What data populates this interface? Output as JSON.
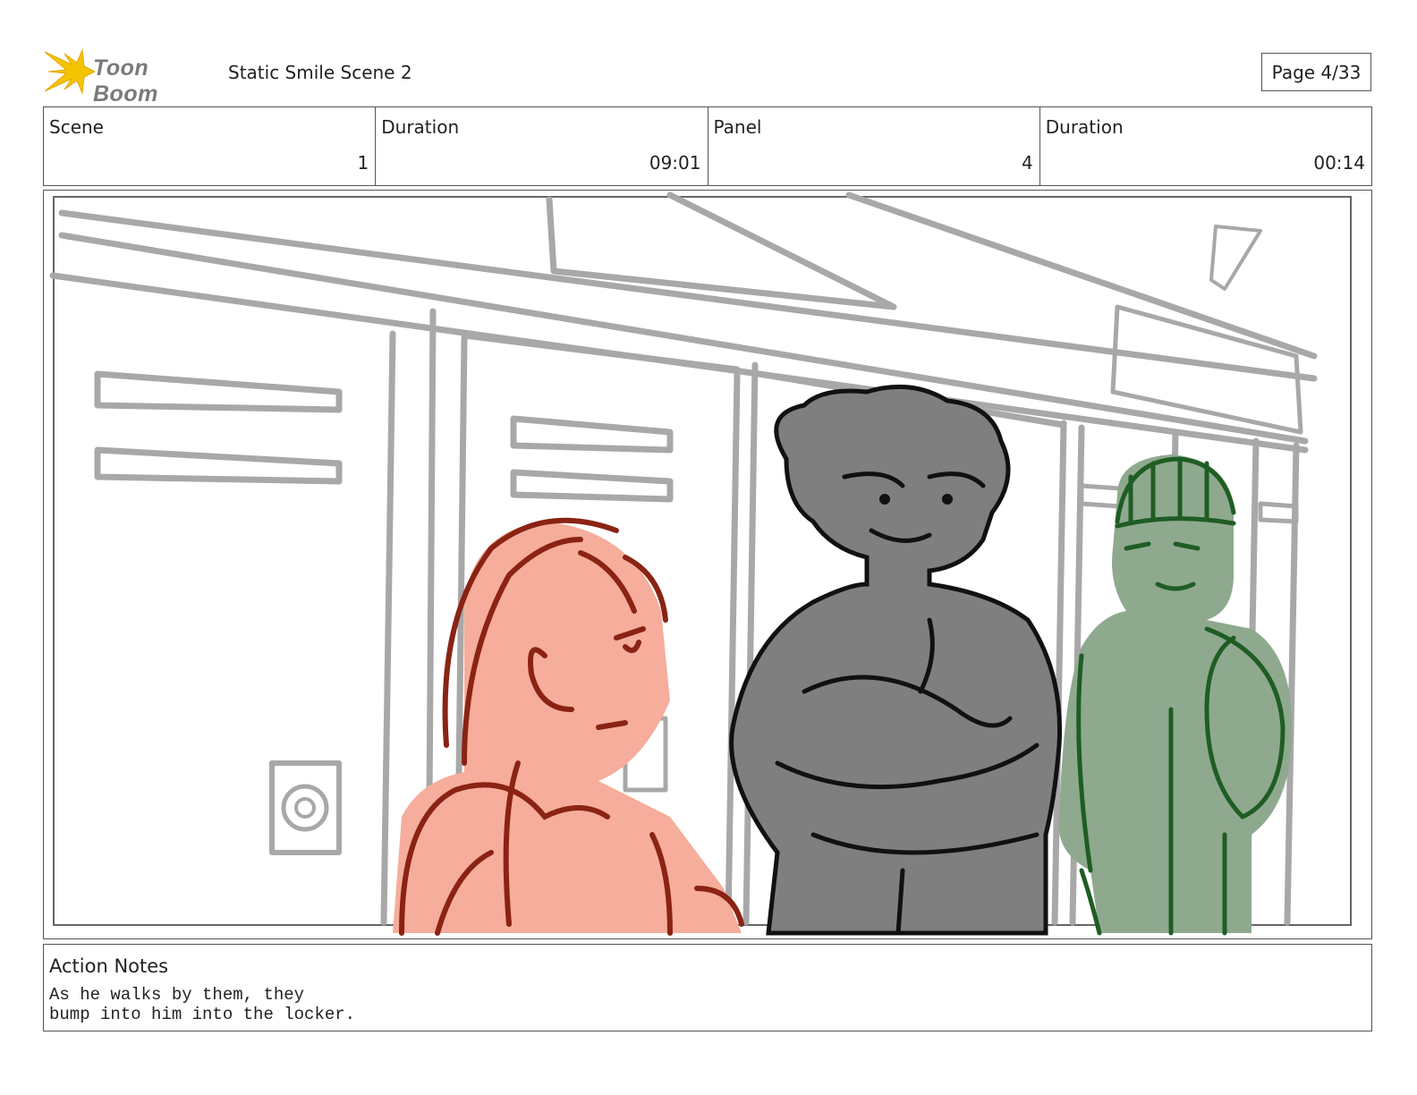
{
  "header": {
    "logo_text": "Toon Boom",
    "doc_title": "Static Smile Scene 2",
    "page": "Page  4/33"
  },
  "info": {
    "scene_label": "Scene",
    "scene_value": "1",
    "scene_duration_label": "Duration",
    "scene_duration_value": "09:01",
    "panel_label": "Panel",
    "panel_value": "4",
    "panel_duration_label": "Duration",
    "panel_duration_value": "00:14"
  },
  "notes": {
    "title": "Action Notes",
    "text": "As he walks by them, they\nbump into him into the locker."
  },
  "colors": {
    "red_character_fill": "#f6ad9b",
    "red_character_line": "#8a2314",
    "gray_character_fill": "#7f7f7f",
    "green_character_fill": "#8fa98f",
    "green_character_line": "#1f5d24",
    "locker_line": "#a8a8a8",
    "logo_star": "#f5c400"
  }
}
